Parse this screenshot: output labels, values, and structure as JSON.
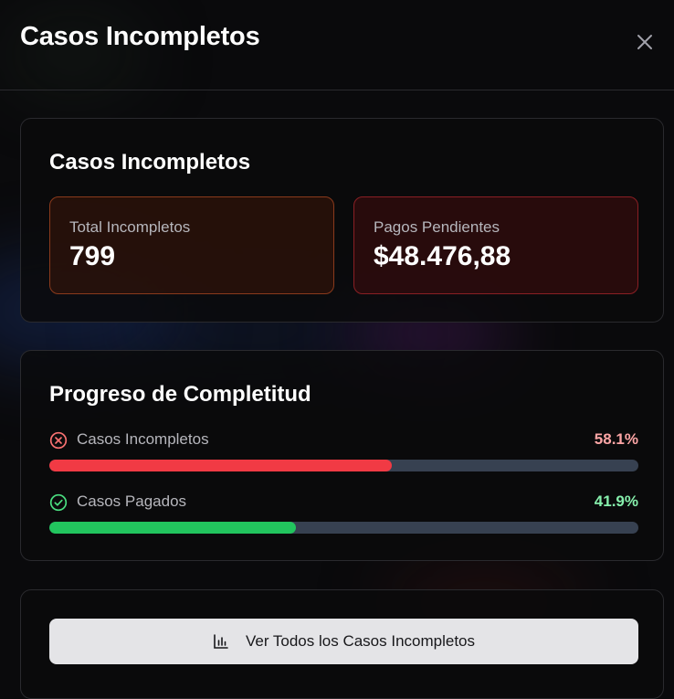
{
  "header": {
    "title": "Casos Incompletos",
    "close_icon": "close-icon"
  },
  "summary": {
    "title": "Casos Incompletos",
    "total": {
      "label": "Total Incompletos",
      "value": "799"
    },
    "pending": {
      "label": "Pagos Pendientes",
      "value": "$48.476,88"
    }
  },
  "progress": {
    "title": "Progreso de Completitud",
    "items": [
      {
        "label": "Casos Incompletos",
        "percent_text": "58.1%",
        "fraction": 0.581,
        "icon": "x-circle-icon",
        "color": "#f13a44",
        "text_color": "#fca5a5"
      },
      {
        "label": "Casos Pagados",
        "percent_text": "41.9%",
        "fraction": 0.419,
        "icon": "check-circle-icon",
        "color": "#22c55e",
        "text_color": "#86efac"
      }
    ]
  },
  "actions": {
    "view_all_label": "Ver Todos los Casos Incompletos",
    "view_all_icon": "bar-chart-icon"
  },
  "colors": {
    "track": "#374151",
    "button_bg": "#e4e4e7"
  }
}
